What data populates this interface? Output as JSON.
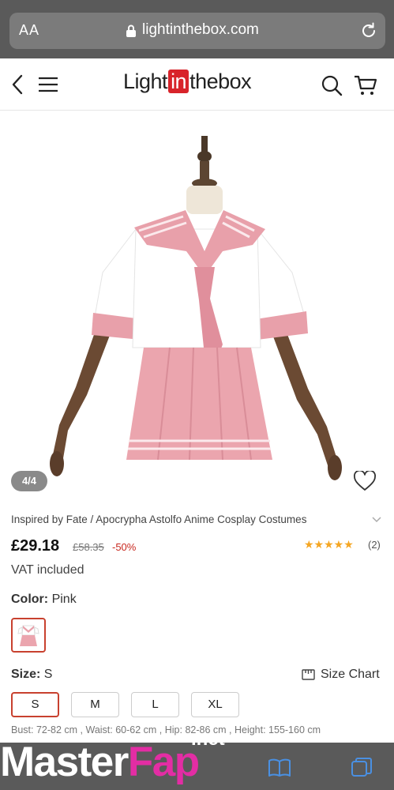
{
  "browser": {
    "aa_label": "AA",
    "url": "lightinthebox.com"
  },
  "header": {
    "logo_pre": "Light",
    "logo_in": "in",
    "logo_post": "thebox"
  },
  "gallery": {
    "counter": "4/4"
  },
  "product": {
    "title": "Inspired by Fate / Apocrypha Astolfo Anime Cosplay Costumes",
    "price": "£29.18",
    "old_price": "£58.35",
    "discount": "-50%",
    "stars": "★★★★★",
    "rating": 5,
    "reviews": "(2)",
    "vat": "VAT included",
    "color_label": "Color:",
    "color_value": "Pink",
    "size_label": "Size:",
    "size_value": "S",
    "size_chart": "Size Chart",
    "sizes": [
      "S",
      "M",
      "L",
      "XL"
    ],
    "dimensions": "Bust: 72-82 cm , Waist: 60-62 cm , Hip: 82-86 cm , Height: 155-160 cm"
  },
  "watermark": {
    "part1": "Master",
    "part2": "Fap",
    "part3": ".net"
  },
  "colors": {
    "accent": "#c8412f",
    "brand_red": "#d8232a",
    "star": "#f5a623",
    "dress_pink": "#e8a0aa"
  }
}
